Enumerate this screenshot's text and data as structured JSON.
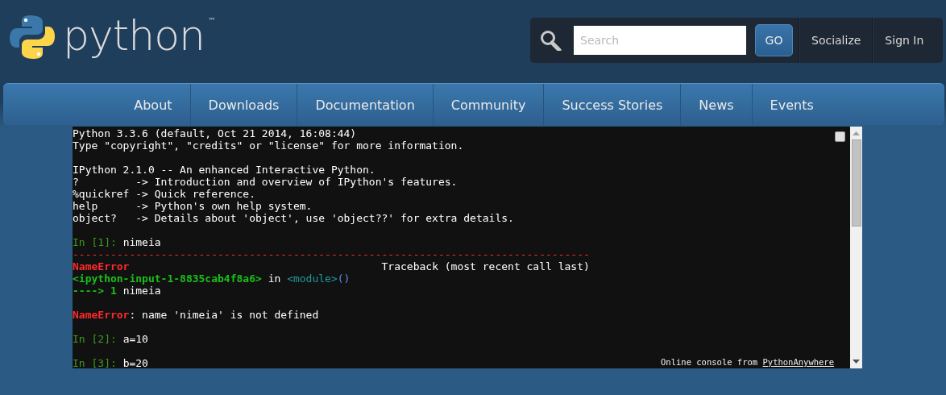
{
  "header": {
    "logo": {
      "wordmark": "python",
      "trademark": "™"
    },
    "search": {
      "placeholder": "Search",
      "button": "GO"
    },
    "links": [
      "Socialize",
      "Sign In"
    ]
  },
  "nav": {
    "items": [
      "About",
      "Downloads",
      "Documentation",
      "Community",
      "Success Stories",
      "News",
      "Events"
    ]
  },
  "console": {
    "blocks": [
      {
        "lines": [
          [
            {
              "kind": "out",
              "text": "Python 3.3.6 (default, Oct 21 2014, 16:08:44)"
            }
          ],
          [
            {
              "kind": "out",
              "text": "Type \"copyright\", \"credits\" or \"license\" for more information."
            }
          ]
        ]
      },
      {
        "lines": [
          [
            {
              "kind": "out",
              "text": "IPython 2.1.0 -- An enhanced Interactive Python."
            }
          ],
          [
            {
              "kind": "out",
              "text": "?         -> Introduction and overview of IPython's features."
            }
          ],
          [
            {
              "kind": "out",
              "text": "%quickref -> Quick reference."
            }
          ],
          [
            {
              "kind": "out",
              "text": "help      -> Python's own help system."
            }
          ],
          [
            {
              "kind": "out",
              "text": "object?   -> Details about 'object', use 'object??' for extra details."
            }
          ]
        ]
      },
      {
        "lines": [
          [
            {
              "kind": "prompt",
              "text": "In [1]: "
            },
            {
              "kind": "out",
              "text": "nimeia"
            }
          ],
          [
            {
              "kind": "rule",
              "text": "----------------------------------------------------------------------------------"
            }
          ],
          [
            {
              "kind": "error",
              "text": "NameError                                        "
            },
            {
              "kind": "out",
              "text": "Traceback (most recent call last)"
            }
          ],
          [
            {
              "kind": "location",
              "text": "<ipython-input-1-8835cab4f8a6>"
            },
            {
              "kind": "out",
              "text": " in "
            },
            {
              "kind": "module",
              "text": "<module>"
            },
            {
              "kind": "paren",
              "text": "()"
            }
          ],
          [
            {
              "kind": "arrow",
              "text": "----> 1 "
            },
            {
              "kind": "out",
              "text": "nimeia"
            }
          ]
        ]
      },
      {
        "lines": [
          [
            {
              "kind": "error",
              "text": "NameError"
            },
            {
              "kind": "out",
              "text": ": name 'nimeia' is not defined"
            }
          ]
        ]
      },
      {
        "lines": [
          [
            {
              "kind": "prompt",
              "text": "In [2]: "
            },
            {
              "kind": "out",
              "text": "a=10"
            }
          ]
        ]
      },
      {
        "lines": [
          [
            {
              "kind": "prompt",
              "text": "In [3]: "
            },
            {
              "kind": "out",
              "text": "b=20"
            }
          ]
        ]
      }
    ],
    "credit": {
      "text": "Online console from ",
      "link": "PythonAnywhere"
    }
  }
}
